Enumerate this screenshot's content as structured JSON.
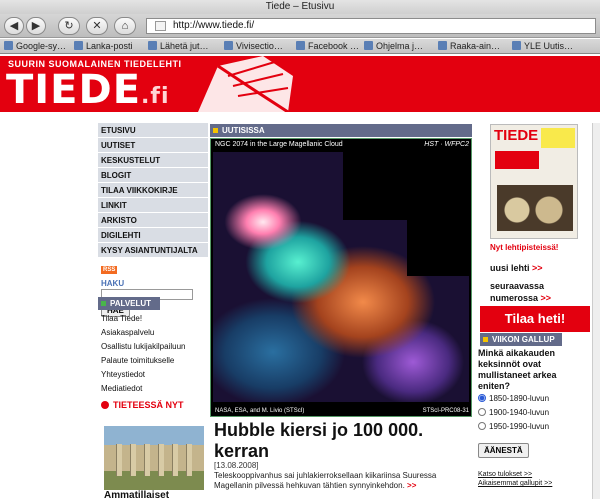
{
  "browser": {
    "window_title": "Tiede – Etusivu",
    "url": "http://www.tiede.fi/",
    "bookmarks": [
      "Google-sy…",
      "Lanka-posti",
      "Lähetä jut…",
      "Vivisectio…",
      "Facebook …",
      "Ohjelma j…",
      "Raaka-ain…",
      "YLE Uutis…"
    ]
  },
  "banner": {
    "tagline": "SUURIN SUOMALAINEN TIEDELEHTI",
    "logo_main": "TIEDE",
    "logo_suffix": ".fi"
  },
  "nav": {
    "items": [
      "ETUSIVU",
      "UUTISET",
      "KESKUSTELUT",
      "BLOGIT",
      "TILAA VIIKKOKIRJE",
      "LINKIT",
      "ARKISTO",
      "DIGILEHTI",
      "KYSY ASIANTUNTIJALTA"
    ],
    "rss_label": "RSS",
    "search_label": "HAKU",
    "search_button": "HAE"
  },
  "palvelut": {
    "header": "PALVELUT",
    "items": [
      "Tilaa Tiede!",
      "Asiakaspalvelu",
      "Osallistu lukijakilpailuun",
      "Palaute toimitukselle",
      "Yhteystiedot",
      "Mediatiedot"
    ]
  },
  "tieteessa": {
    "label": "TIETEESSÄ NYT",
    "article_title": "Ammatillaiset"
  },
  "news": {
    "header": "UUTISISSA",
    "photo_caption": "NGC 2074 in the Large Magellanic Cloud",
    "photo_tag": "HST · WFPC2",
    "photo_credit_left": "NASA, ESA, and M. Livio (STScI)",
    "photo_credit_right": "STScI-PRC08-31",
    "headline": "Hubble kiersi jo 100 000. kerran",
    "date": "[13.08.2008]",
    "body": "Teleskooppivanhus sai juhlakierroksellaan kiikariinsa Suuressa Magellanin pilvessä hehkuvan tähtien synnyinkehdon.",
    "more": ">>"
  },
  "magazine": {
    "cover_title": "TIEDE",
    "promo1": "Nyt lehtipisteissä!",
    "promo2": "uusi lehti",
    "promo3": "seuraavassa numerossa",
    "arrows": ">>",
    "subscribe": "Tilaa heti!"
  },
  "gallup": {
    "header": "VIIKON GALLUP",
    "question": "Minkä aikakauden keksinnöt ovat mullistaneet arkea eniten?",
    "options": [
      "1850-1890-luvun",
      "1900-1940-luvun",
      "1950-1990-luvun"
    ],
    "selected_index": 0,
    "vote_button": "ÄÄNESTÄ",
    "link_results": "Katso tulokset >>",
    "link_archive": "Aikaisemmat gallupit >>"
  }
}
